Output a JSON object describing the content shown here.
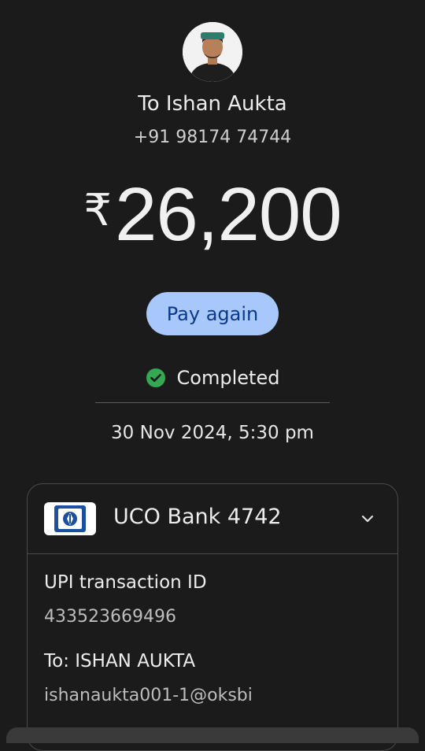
{
  "header": {
    "avatar_icon": "person-avatar",
    "recipient": "To Ishan Aukta",
    "phone": "+91 98174 74744"
  },
  "payment": {
    "currency_symbol": "₹",
    "amount": "26,200",
    "pay_again_label": "Pay again",
    "status_icon": "check-circle-icon",
    "status_color": "#34a853",
    "status": "Completed",
    "datetime": "30 Nov 2024, 5:30 pm"
  },
  "details": {
    "bank_icon": "uco-bank-logo",
    "bank_name": "UCO Bank 4742",
    "expand_icon": "chevron-down-icon",
    "txn_label": "UPI transaction ID",
    "txn_id": "433523669496",
    "to_label": "To: ISHAN  AUKTA",
    "to_upi": "ishanaukta001-1@oksbi"
  },
  "colors": {
    "background": "#1b1b1b",
    "pay_again_bg": "#a8c7fa",
    "pay_again_text": "#0b3a8c",
    "bank_blue": "#1b4fa0"
  }
}
